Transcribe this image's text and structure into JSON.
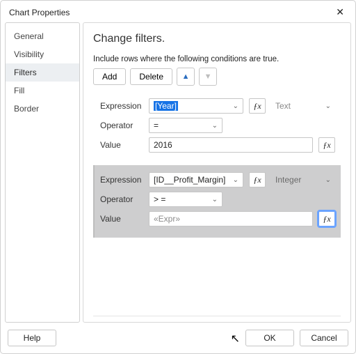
{
  "window": {
    "title": "Chart Properties"
  },
  "sidebar": {
    "items": [
      {
        "label": "General",
        "selected": false
      },
      {
        "label": "Visibility",
        "selected": false
      },
      {
        "label": "Filters",
        "selected": true
      },
      {
        "label": "Fill",
        "selected": false
      },
      {
        "label": "Border",
        "selected": false
      }
    ]
  },
  "main": {
    "title": "Change filters.",
    "subtitle": "Include rows where the following conditions are true.",
    "toolbar": {
      "add": "Add",
      "delete": "Delete"
    }
  },
  "filters": [
    {
      "selected": false,
      "expr_label": "Expression",
      "expr_value": "[Year]",
      "expr_highlighted": true,
      "type_label": "Text",
      "op_label": "Operator",
      "op_value": "=",
      "val_label": "Value",
      "val_value": "2016"
    },
    {
      "selected": true,
      "expr_label": "Expression",
      "expr_value": "[ID__Profit_Margin]",
      "expr_highlighted": false,
      "type_label": "Integer",
      "op_label": "Operator",
      "op_value": "> =",
      "val_label": "Value",
      "val_value": "«Expr»",
      "val_grey": true,
      "fx_focused": true
    }
  ],
  "footer": {
    "help": "Help",
    "ok": "OK",
    "cancel": "Cancel"
  }
}
